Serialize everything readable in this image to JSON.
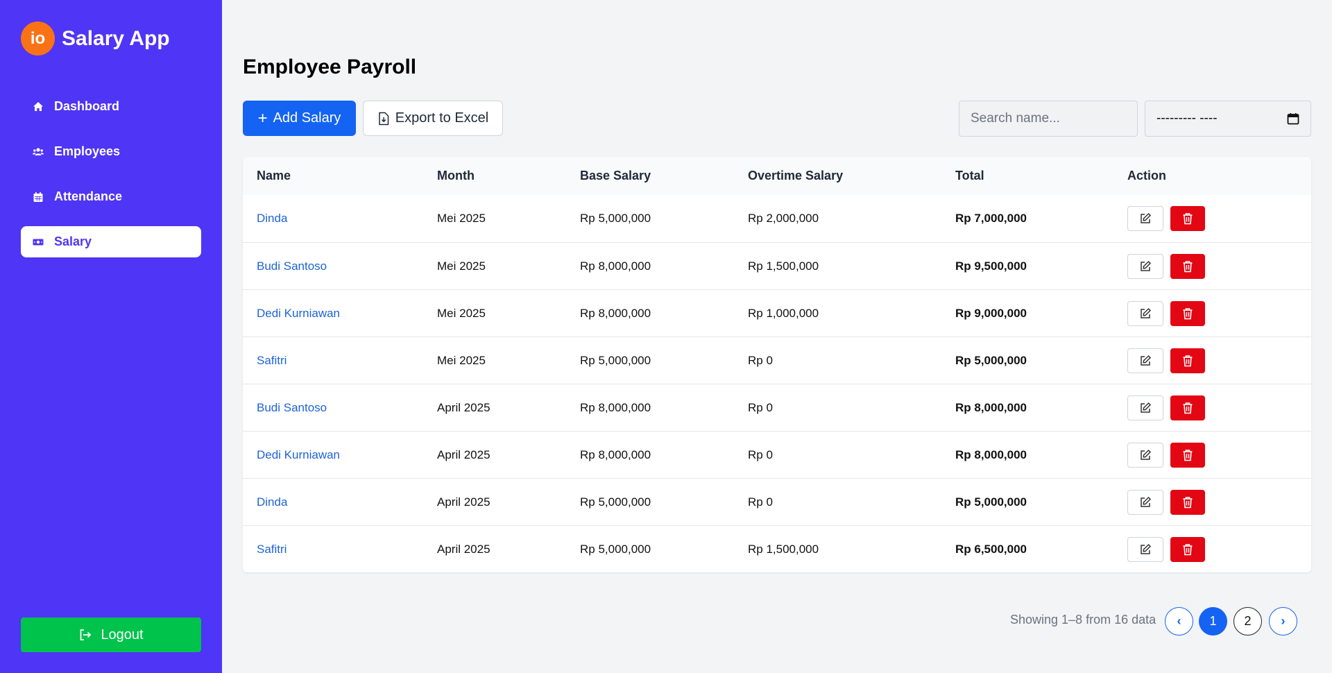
{
  "app": {
    "logo_text": "io",
    "title": "Salary App"
  },
  "sidebar": {
    "items": [
      {
        "label": "Dashboard",
        "icon": "home-icon"
      },
      {
        "label": "Employees",
        "icon": "users-icon"
      },
      {
        "label": "Attendance",
        "icon": "calendar-icon"
      },
      {
        "label": "Salary",
        "icon": "money-icon",
        "active": true
      }
    ],
    "logout_label": "Logout"
  },
  "page": {
    "title": "Employee Payroll"
  },
  "toolbar": {
    "add_label": "Add Salary",
    "export_label": "Export to Excel",
    "search_placeholder": "Search name...",
    "month_value": "--------- ----"
  },
  "table": {
    "headers": [
      "Name",
      "Month",
      "Base Salary",
      "Overtime Salary",
      "Total",
      "Action"
    ],
    "rows": [
      {
        "name": "Dinda",
        "month": "Mei 2025",
        "base": "Rp 5,000,000",
        "overtime": "Rp 2,000,000",
        "total": "Rp 7,000,000"
      },
      {
        "name": "Budi Santoso",
        "month": "Mei 2025",
        "base": "Rp 8,000,000",
        "overtime": "Rp 1,500,000",
        "total": "Rp 9,500,000"
      },
      {
        "name": "Dedi Kurniawan",
        "month": "Mei 2025",
        "base": "Rp 8,000,000",
        "overtime": "Rp 1,000,000",
        "total": "Rp 9,000,000"
      },
      {
        "name": "Safitri",
        "month": "Mei 2025",
        "base": "Rp 5,000,000",
        "overtime": "Rp 0",
        "total": "Rp 5,000,000"
      },
      {
        "name": "Budi Santoso",
        "month": "April 2025",
        "base": "Rp 8,000,000",
        "overtime": "Rp 0",
        "total": "Rp 8,000,000"
      },
      {
        "name": "Dedi Kurniawan",
        "month": "April 2025",
        "base": "Rp 8,000,000",
        "overtime": "Rp 0",
        "total": "Rp 8,000,000"
      },
      {
        "name": "Dinda",
        "month": "April 2025",
        "base": "Rp 5,000,000",
        "overtime": "Rp 0",
        "total": "Rp 5,000,000"
      },
      {
        "name": "Safitri",
        "month": "April 2025",
        "base": "Rp 5,000,000",
        "overtime": "Rp 1,500,000",
        "total": "Rp 6,500,000"
      }
    ]
  },
  "pagination": {
    "summary": "Showing 1–8 from 16 data",
    "prev": "‹",
    "pages": [
      "1",
      "2"
    ],
    "current": "1",
    "next": "›"
  },
  "colors": {
    "sidebar": "#4f35f5",
    "primary": "#1463f3",
    "logout": "#00c34c",
    "danger": "#e30613",
    "logo": "#f97316",
    "link": "#1d63d8"
  }
}
